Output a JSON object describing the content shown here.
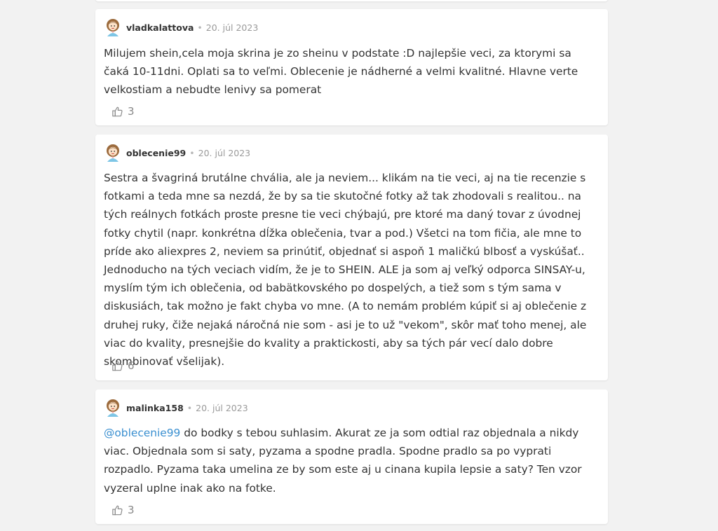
{
  "colors": {
    "background": "#f2f2f2",
    "card": "#ffffff",
    "mention": "#3a8fd0",
    "meta": "#9a9a9a"
  },
  "separator": "•",
  "comments": [
    {
      "username": "vladkalattova",
      "date": "20. júl 2023",
      "avatar_icon": "girl-avatar-icon",
      "text": "Milujem shein,cela moja skrina je zo sheinu v podstate :D najlepšie veci, za ktorymi sa čaká 10-11dni. Oplati sa to veľmi. Oblecenie je nádherné a velmi kvalitné. Hlavne verte velkostiam a nebudte lenivy sa pomerat",
      "likes": "3"
    },
    {
      "username": "oblecenie99",
      "date": "20. júl 2023",
      "avatar_icon": "girl-avatar-icon",
      "text": "Sestra a švagriná brutálne chvália, ale ja neviem... klikám na tie veci, aj na tie recenzie s fotkami a teda mne sa nezdá, že by sa tie skutočné fotky až tak zhodovali s realitou.. na tých reálnych fotkách proste presne tie veci chýbajú, pre ktoré ma daný tovar z úvodnej fotky chytil (napr. konkrétna dĺžka oblečenia, tvar a pod.) Všetci na tom fičia, ale mne to príde ako aliexpres 2, neviem sa prinútiť, objednať si aspoň 1 maličkú blbosť a vyskúšať.. Jednoducho na tých veciach vidím, že je to SHEIN. ALE ja som aj veľký odporca SINSAY-u, myslím tým ich oblečenia, od babätkovského po dospelých, a tiež som s tým sama v diskusiách, tak možno je fakt chyba vo mne. (A to nemám problém kúpiť si aj oblečenie z druhej ruky, čiže nejaká náročná nie som - asi je to už \"vekom\", skôr mať toho menej, ale viac do kvality, presnejšie do kvality a praktickosti, aby sa tých pár vecí dalo dobre skombinovať všelijak).",
      "likes": "6"
    },
    {
      "username": "malinka158",
      "date": "20. júl 2023",
      "avatar_icon": "girl-avatar-icon",
      "mention": "@oblecenie99",
      "text": " do bodky s tebou suhlasim. Akurat ze ja som odtial raz objednala a nikdy viac. Objednala som si saty, pyzama a spodne pradla. Spodne pradlo sa po vyprati rozpadlo. Pyzama taka umelina ze by som este aj u cinana kupila lepsie a saty? Ten vzor vyzeral uplne inak ako na fotke.",
      "likes": "3"
    }
  ]
}
